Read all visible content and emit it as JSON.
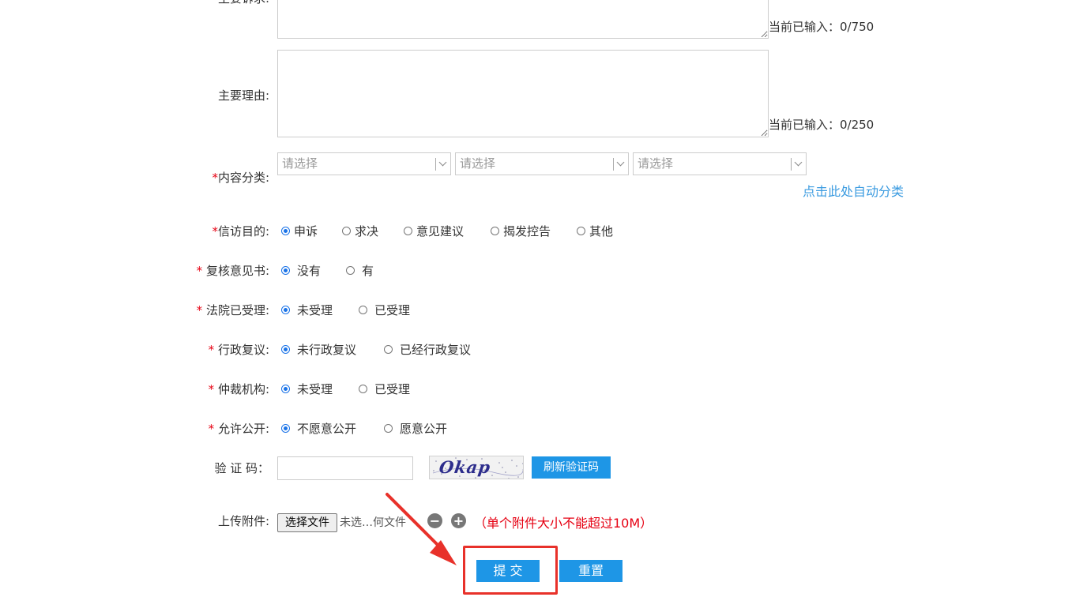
{
  "fields": {
    "main_request": {
      "label": "主要诉求:",
      "counter": "当前已输入：0/750"
    },
    "main_reason": {
      "label": "主要理由:",
      "counter": "当前已输入：0/250"
    },
    "content_category": {
      "required_mark": "*",
      "label": "内容分类:",
      "selects": [
        "请选择",
        "请选择",
        "请选择"
      ],
      "auto_classify_link": "点击此处自动分类"
    },
    "petition_purpose": {
      "required_mark": "*",
      "label": "信访目的:",
      "options": [
        "申诉",
        "求决",
        "意见建议",
        "揭发控告",
        "其他"
      ],
      "selected": "申诉"
    },
    "review_opinion": {
      "required_mark": "*",
      "label": " 复核意见书:",
      "options": [
        "没有",
        "有"
      ],
      "selected": "没有"
    },
    "court_accepted": {
      "required_mark": "*",
      "label": " 法院已受理:",
      "options": [
        "未受理",
        "已受理"
      ],
      "selected": "未受理"
    },
    "admin_review": {
      "required_mark": "*",
      "label": " 行政复议:",
      "options": [
        "未行政复议",
        "已经行政复议"
      ],
      "selected": "未行政复议"
    },
    "arbitration": {
      "required_mark": "*",
      "label": " 仲裁机构:",
      "options": [
        "未受理",
        "已受理"
      ],
      "selected": "未受理"
    },
    "allow_public": {
      "required_mark": "*",
      "label": " 允许公开:",
      "options": [
        "不愿意公开",
        "愿意公开"
      ],
      "selected": "不愿意公开"
    },
    "captcha": {
      "label": "验 证 码：",
      "input_value": "",
      "image_text": "Okap",
      "refresh_label": "刷新验证码"
    },
    "attachment": {
      "label": "上传附件:",
      "choose_file_label": "选择文件",
      "file_status": "未选…何文件",
      "remove_icon": "minus-circle-icon",
      "add_icon": "plus-circle-icon",
      "size_note": "（单个附件大小不能超过10M）"
    }
  },
  "actions": {
    "submit_label": "提 交",
    "reset_label": "重置"
  },
  "colors": {
    "accent": "#1e96e6",
    "required": "#e60012",
    "link": "#3b9be0",
    "annotation": "#e8312a"
  }
}
